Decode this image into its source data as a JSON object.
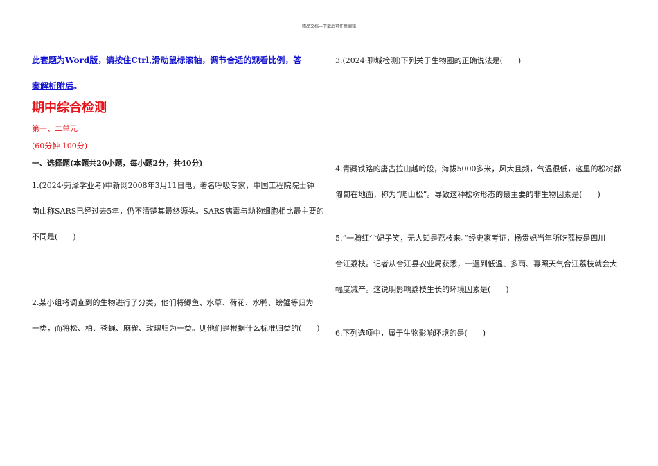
{
  "header": "精品文档---下载后可任意编辑",
  "notice": {
    "line1": "此套题为Word版，请按住Ctrl,滑动鼠标滚轴，调节合适的观看比例，答",
    "line2": "案解析附后",
    "line2_end": "。"
  },
  "title": "期中综合检测",
  "unit": "第一、二单元",
  "time_score": "(60分钟 100分)",
  "section": "一、选择题(本题共20小题，每小题2分，共40分)",
  "questions": [
    {
      "lines": [
        "1.(2024·菏泽学业考)中新网2008年3月11日电，著名呼吸专家，中国工程院院士钟",
        "南山称SARS已经过去5年，仍不清楚其最终源头。SARS病毒与动物细胞相比最主要的",
        "不同是(　　)"
      ]
    },
    {
      "lines": [
        "2.某小组将调查到的生物进行了分类，他们将鲫鱼、水草、荷花、水鸭、螃蟹等归为",
        "一类，而将松、柏、苍蝇、麻雀、玫瑰归为一类。则他们是根据什么标准归类的(　　)"
      ]
    },
    {
      "lines": [
        "3.(2024·聊城检测)下列关于生物圈的正确说法是(　　)"
      ]
    },
    {
      "lines": [
        "4.青藏铁路的唐古拉山越岭段，海拔5000多米，风大且频，气温很低，这里的松树都",
        "匍匐在地面，称为“爬山松”。导致这种松树形态的最主要的非生物因素是(　　)"
      ]
    },
    {
      "lines": [
        "5.“一骑红尘妃子笑，无人知是荔枝来。”经史家考证，杨贵妃当年所吃荔枝是四川",
        "合江荔枝。记者从合江县农业局获悉，一遇到低温、多雨、寡照天气合江荔枝就会大",
        "幅度减产。这说明影响荔枝生长的环境因素是(　　)"
      ]
    },
    {
      "lines": [
        "6.下列选项中，属于生物影响环境的是(　　)"
      ]
    }
  ]
}
